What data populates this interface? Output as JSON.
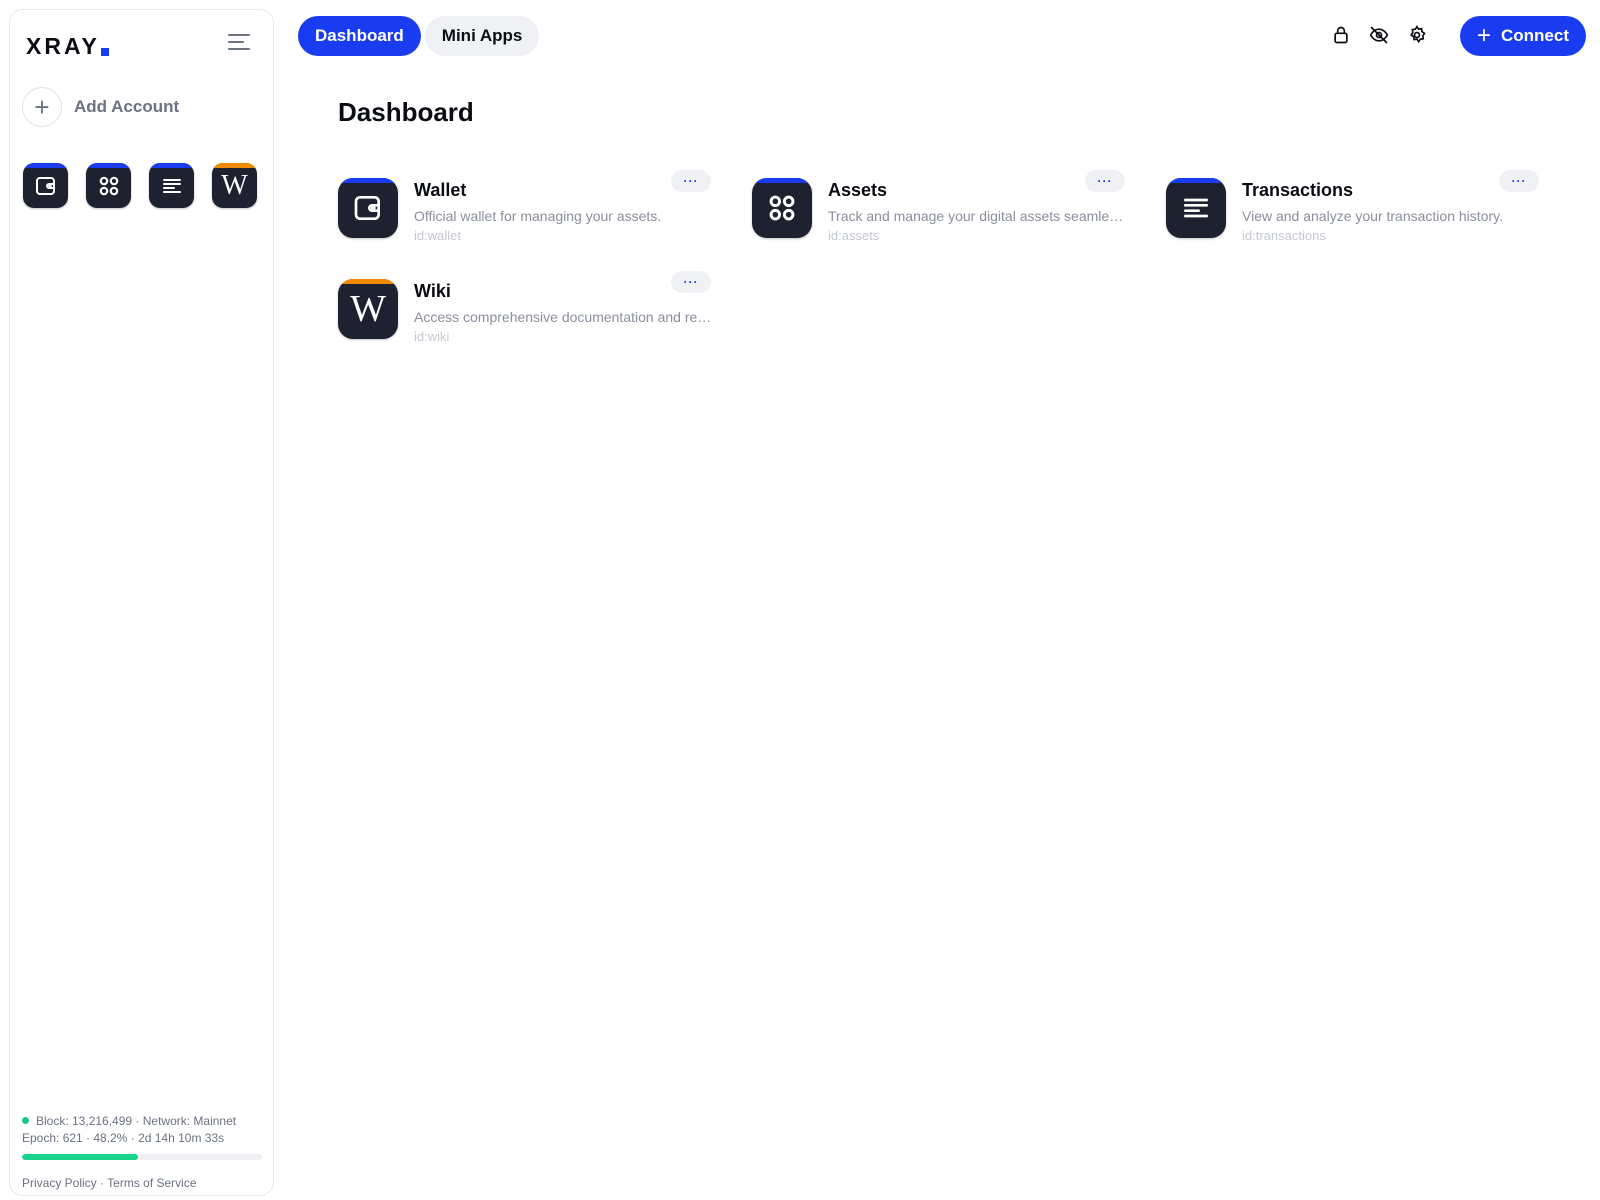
{
  "brand": {
    "logo": "XRAY",
    "accent_color": "#1a3cf0"
  },
  "sidebar": {
    "menu_icon": "hamburger-icon",
    "add_account_label": "Add Account",
    "apps": [
      {
        "name": "Wallet",
        "icon": "wallet-icon",
        "accent": "#1a3cf0"
      },
      {
        "name": "Assets",
        "icon": "grid-icon",
        "accent": "#1a3cf0"
      },
      {
        "name": "Transactions",
        "icon": "list-lines-icon",
        "accent": "#1a3cf0"
      },
      {
        "name": "Wiki",
        "icon": "wikipedia-w-icon",
        "accent": "#f08a00"
      }
    ],
    "status_line1": "Block: 13,216,499 · Network: Mainnet",
    "status_line2": "Epoch: 621 · 48.2% · 2d 14h 10m 33s",
    "epoch_progress_percent": 48.2,
    "status_color": "#16c784",
    "privacy_label": "Privacy Policy",
    "separator": "·",
    "terms_label": "Terms of Service"
  },
  "header": {
    "tabs": [
      {
        "label": "Dashboard",
        "active": true
      },
      {
        "label": "Mini Apps",
        "active": false
      }
    ],
    "icons": [
      "lock-icon",
      "eye-off-icon",
      "gear-icon"
    ],
    "connect_label": "Connect"
  },
  "main": {
    "title": "Dashboard",
    "cards": [
      {
        "name": "Wallet",
        "description": "Official wallet for managing your assets.",
        "id": "id:wallet",
        "more": "···"
      },
      {
        "name": "Assets",
        "description": "Track and manage your digital assets seamlessly.",
        "id": "id:assets",
        "more": "···"
      },
      {
        "name": "Transactions",
        "description": "View and analyze your transaction history.",
        "id": "id:transactions",
        "more": "···"
      },
      {
        "name": "Wiki",
        "description": "Access comprehensive documentation and resources.",
        "id": "id:wiki",
        "more": "···"
      }
    ]
  }
}
